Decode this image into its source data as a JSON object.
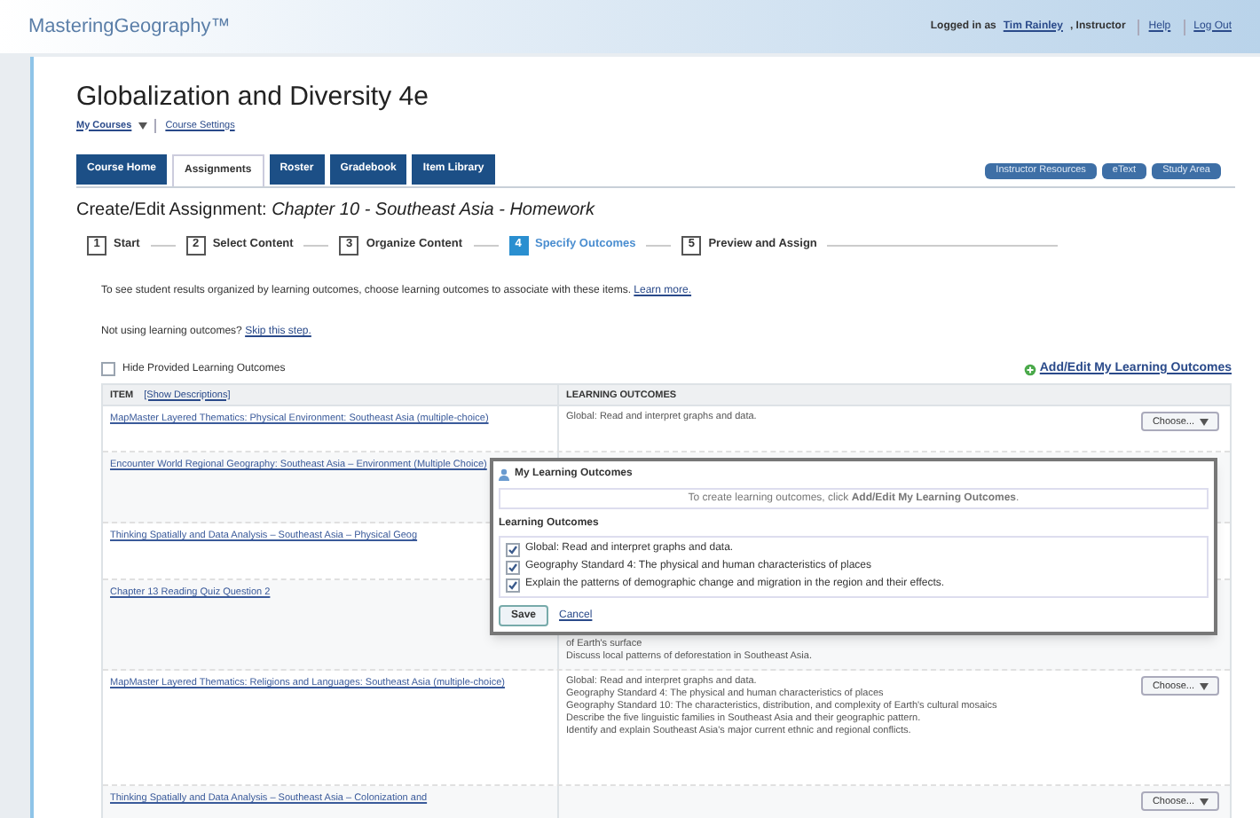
{
  "header": {
    "logo": "MasteringGeography™",
    "login_text": "Logged in as",
    "user": "Tim Rainley",
    "role": ", Instructor",
    "links": [
      "Help",
      "Log Out"
    ]
  },
  "course": {
    "title": "Globalization and Diversity 4e",
    "links": [
      "My Courses",
      "Course Settings"
    ]
  },
  "tabs": [
    {
      "label": "Course Home",
      "selected": false
    },
    {
      "label": "Assignments",
      "selected": true
    },
    {
      "label": "Roster",
      "selected": false
    },
    {
      "label": "Gradebook",
      "selected": false
    },
    {
      "label": "Item Library",
      "selected": false
    }
  ],
  "resource_buttons": [
    "Instructor Resources",
    "eText",
    "Study Area"
  ],
  "heading": "Create/Edit Assignment: *Chapter 10 - Southeast Asia - Homework*",
  "steps": [
    {
      "number": "1",
      "label": "Start",
      "selected": false
    },
    {
      "number": "2",
      "label": "Select Content",
      "selected": false
    },
    {
      "number": "3",
      "label": "Organize Content",
      "selected": false
    },
    {
      "number": "4",
      "label": "Specify Outcomes",
      "selected": true
    },
    {
      "number": "5",
      "label": "Preview and Assign",
      "selected": false
    }
  ],
  "intro": {
    "text": "To see student results organized by learning outcomes, choose learning outcomes to associate with these items.",
    "link": "Learn more."
  },
  "skip": {
    "text": "Not using learning outcomes?",
    "link": "Skip this step."
  },
  "hide_provided": {
    "label": "Hide Provided Learning Outcomes",
    "checked": false
  },
  "add_edit_link": "Add/Edit My Learning Outcomes",
  "table": {
    "columns": [
      "ITEM",
      "LEARNING OUTCOMES"
    ],
    "column_link": "[Show Descriptions]",
    "rows": [
      {
        "item": "MapMaster Layered Thematics: Physical Environment: Southeast Asia (multiple-choice)",
        "outcomes": [
          "Global: Read and interpret graphs and data."
        ],
        "button": "Choose..."
      },
      {
        "item": "Encounter World Regional Geography: Southeast Asia – Environment (Multiple Choice)",
        "outcomes": []
      },
      {
        "item": "Thinking Spatially and Data Analysis – Southeast Asia – Physical Geog",
        "outcomes": []
      },
      {
        "item": "Chapter 13 Reading Quiz Question 2",
        "outcomes": [
          "of Earth's surface",
          "Discuss local patterns of deforestation in Southeast Asia."
        ]
      },
      {
        "item": "MapMaster Layered Thematics: Religions and Languages: Southeast Asia (multiple-choice)",
        "outcomes": [
          "Global: Read and interpret graphs and data.",
          "Geography Standard 4: The physical and human characteristics of places",
          "Geography Standard 10: The characteristics, distribution, and complexity of Earth's cultural mosaics",
          "Describe the five linguistic families in Southeast Asia and their geographic pattern.",
          "Identify and explain Southeast Asia's major current ethnic and regional conflicts."
        ],
        "button": "Choose..."
      },
      {
        "item": "Thinking Spatially and Data Analysis – Southeast Asia – Colonization and",
        "outcomes": [],
        "button": "Choose..."
      }
    ]
  },
  "popup": {
    "title": "My Learning Outcomes",
    "info": "To create learning outcomes, click **Add/Edit My Learning Outcomes**.",
    "section": "Learning Outcomes",
    "options": [
      {
        "label": "Global: Read and interpret graphs and data.",
        "checked": true
      },
      {
        "label": "Geography Standard 4: The physical and human characteristics of places",
        "checked": true
      },
      {
        "label": "Explain the patterns of demographic change and migration in the region and their effects.",
        "checked": true
      }
    ],
    "save": "Save",
    "cancel": "Cancel"
  }
}
